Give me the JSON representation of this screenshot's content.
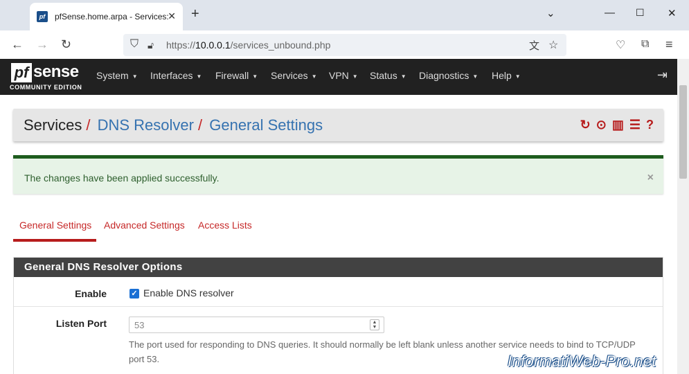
{
  "browser": {
    "tab_title": "pfSense.home.arpa - Services: D",
    "favicon_text": "pf",
    "url_prefix": "https://",
    "url_host": "10.0.0.1",
    "url_path": "/services_unbound.php"
  },
  "pfsense": {
    "logo_pf": "pf",
    "logo_sense": "sense",
    "logo_edition": "COMMUNITY EDITION",
    "menu": [
      "System",
      "Interfaces",
      "Firewall",
      "Services",
      "VPN",
      "Status",
      "Diagnostics",
      "Help"
    ]
  },
  "breadcrumb": {
    "root": "Services",
    "item1": "DNS Resolver",
    "item2": "General Settings",
    "separator": "/"
  },
  "alert": {
    "message": "The changes have been applied successfully.",
    "close": "×"
  },
  "tabs": [
    "General Settings",
    "Advanced Settings",
    "Access Lists"
  ],
  "panel": {
    "title": "General DNS Resolver Options",
    "enable_label": "Enable",
    "enable_checkbox_label": "Enable DNS resolver",
    "enable_checked": true,
    "listen_port_label": "Listen Port",
    "listen_port_placeholder": "53",
    "listen_port_help": "The port used for responding to DNS queries. It should normally be left blank unless another service needs to bind to TCP/UDP port 53."
  },
  "watermark": "InformatiWeb-Pro.net",
  "colors": {
    "nav_bg": "#212121",
    "accent_red": "#c62828",
    "link_blue": "#3572b0",
    "success_green": "#1e5c1e",
    "panel_header": "#424242"
  },
  "icons": {
    "reload": "reload-icon",
    "stop": "stop-icon",
    "chart": "chart-icon",
    "log": "log-icon",
    "help": "help-icon"
  }
}
